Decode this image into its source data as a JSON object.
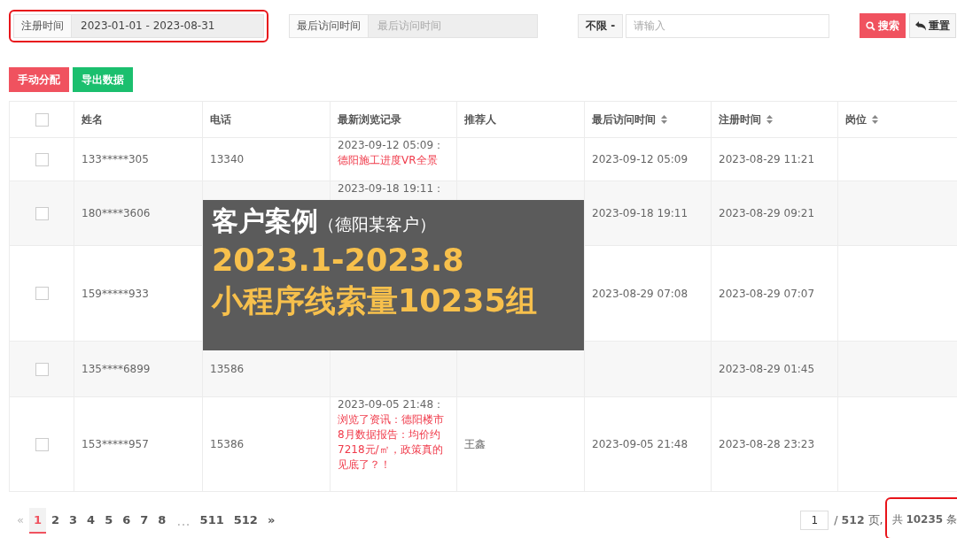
{
  "filters": [
    {
      "label": "注册时间",
      "value": "2023-01-01 - 2023-08-31",
      "highlighted": true
    },
    {
      "label": "最后访问时间",
      "placeholder": "最后访问时间",
      "highlighted": false
    }
  ],
  "search": {
    "scope": "不限 -",
    "placeholder": "请输入"
  },
  "buttons": [
    {
      "label": "搜索",
      "kind": "search"
    },
    {
      "label": "重置",
      "kind": "reset"
    }
  ],
  "actions": [
    {
      "label": "手动分配",
      "color": "#f0525f"
    },
    {
      "label": "导出数据",
      "color": "#1bbf6e"
    }
  ],
  "table": {
    "select_all_checked": false,
    "columns": [
      {
        "label": "姓名",
        "sortable": false
      },
      {
        "label": "电话",
        "sortable": false
      },
      {
        "label": "最新浏览记录",
        "sortable": false
      },
      {
        "label": "推荐人",
        "sortable": false
      },
      {
        "label": "最后访问时间",
        "sortable": true
      },
      {
        "label": "注册时间",
        "sortable": true
      },
      {
        "label": "岗位",
        "sortable": true
      }
    ],
    "rows": [
      {
        "checked": false,
        "name": "133*****305",
        "phone": "13340",
        "history_time": "2023-09-12 05:09：",
        "history_text": "德阳施工进度VR全景",
        "last_visit": "2023-09-12 05:09",
        "registered": "2023-08-29 11:21"
      },
      {
        "checked": false,
        "name": "180****3606",
        "history_time": "2023-09-18 19:11：",
        "last_visit": "2023-09-18 19:11",
        "registered": "2023-08-29 09:21"
      },
      {
        "checked": false,
        "name": "159*****933",
        "last_visit": "2023-08-29 07:08",
        "registered": "2023-08-29 07:07"
      },
      {
        "checked": false,
        "name": "135****6899",
        "phone": "13586",
        "registered": "2023-08-29 01:45"
      },
      {
        "checked": false,
        "name": "153*****957",
        "phone": "15386",
        "history_time": "2023-09-05 21:48：",
        "history_text": "浏览了资讯：德阳楼市8月数据报告：均价约7218元/㎡，政策真的见底了？！",
        "referrer": "王鑫",
        "last_visit": "2023-09-05 21:48",
        "registered": "2023-08-28 23:23"
      }
    ]
  },
  "pagination": {
    "pages": [
      {
        "label": "«",
        "kind": "prev",
        "disabled": true
      },
      {
        "label": "1",
        "kind": "page",
        "selected": true
      },
      {
        "label": "2",
        "kind": "page",
        "selected": false
      },
      {
        "label": "3",
        "kind": "page",
        "selected": false
      },
      {
        "label": "4",
        "kind": "page",
        "selected": false
      },
      {
        "label": "5",
        "kind": "page",
        "selected": false
      },
      {
        "label": "6",
        "kind": "page",
        "selected": false
      },
      {
        "label": "7",
        "kind": "page",
        "selected": false
      },
      {
        "label": "8",
        "kind": "page",
        "selected": false
      },
      {
        "label": "...",
        "kind": "ellipsis"
      },
      {
        "label": "511",
        "kind": "page",
        "selected": false
      },
      {
        "label": "512",
        "kind": "page",
        "selected": false
      },
      {
        "label": "»",
        "kind": "next",
        "disabled": false
      }
    ],
    "page_input": "1",
    "page_total": "/ **512** 页,",
    "total": "共 **10235** 条",
    "total_highlighted": true
  },
  "promo": {
    "title": "客户案例",
    "subtitle": "（德阳某客户）",
    "lines": [
      "2023.1-2023.8",
      "小程序线索量10235组"
    ]
  }
}
